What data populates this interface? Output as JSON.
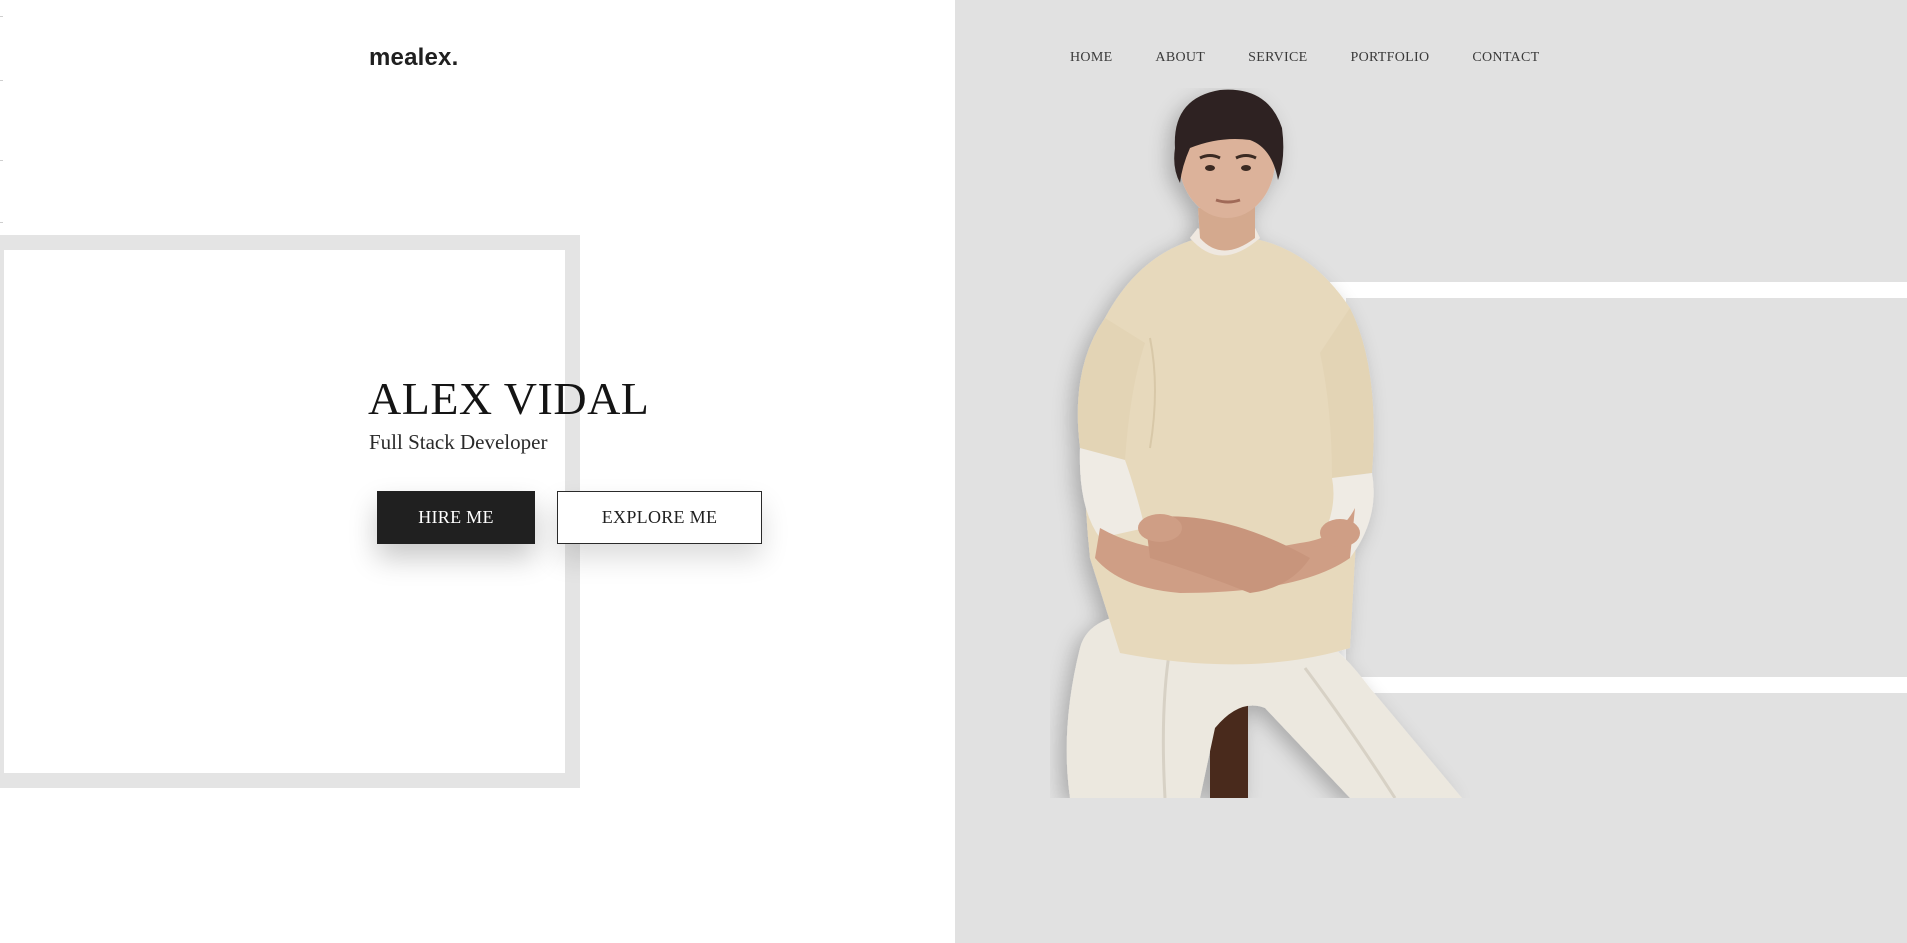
{
  "brand": {
    "logo_text": "mealex."
  },
  "nav": {
    "items": [
      {
        "label": "HOME"
      },
      {
        "label": "ABOUT"
      },
      {
        "label": "SERVICE"
      },
      {
        "label": "PORTFOLIO"
      },
      {
        "label": "CONTACT"
      }
    ]
  },
  "hero": {
    "name": "ALEX VIDAL",
    "role": "Full Stack Developer",
    "hire_label": "HIRE ME",
    "explore_label": "EXPLORE ME",
    "portrait_icon": "person-portrait-photo"
  },
  "colors": {
    "panel_gray": "#e1e1e1",
    "dark_button": "#202020",
    "text_dark": "#141414"
  }
}
